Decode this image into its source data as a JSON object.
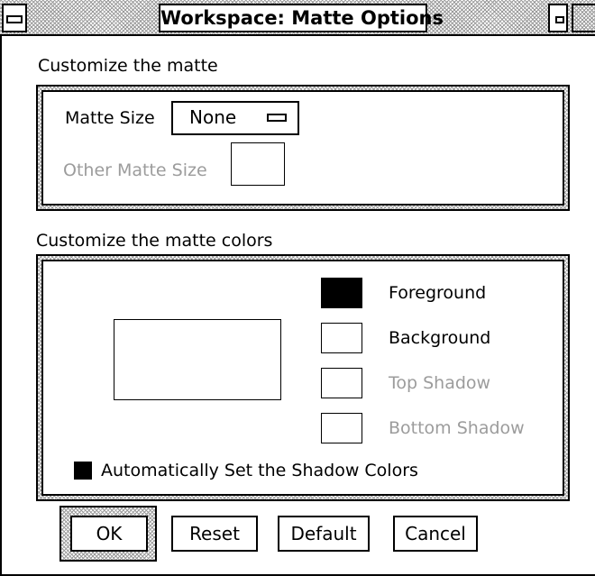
{
  "window": {
    "title": "Workspace: Matte Options"
  },
  "matte_group": {
    "heading": "Customize the matte",
    "size_label": "Matte Size",
    "size_value": "None",
    "other_size_label": "Other Matte Size",
    "other_size_value": ""
  },
  "colors_group": {
    "heading": "Customize the matte colors",
    "swatches": [
      {
        "label": "Foreground",
        "color": "#000000",
        "enabled": true
      },
      {
        "label": "Background",
        "color": "#ffffff",
        "enabled": true
      },
      {
        "label": "Top Shadow",
        "color": "#ffffff",
        "enabled": false
      },
      {
        "label": "Bottom Shadow",
        "color": "#ffffff",
        "enabled": false
      }
    ],
    "auto_shadow_label": "Automatically Set the Shadow Colors",
    "auto_shadow_checked": true
  },
  "buttons": {
    "ok": "OK",
    "reset": "Reset",
    "default": "Default",
    "cancel": "Cancel"
  }
}
